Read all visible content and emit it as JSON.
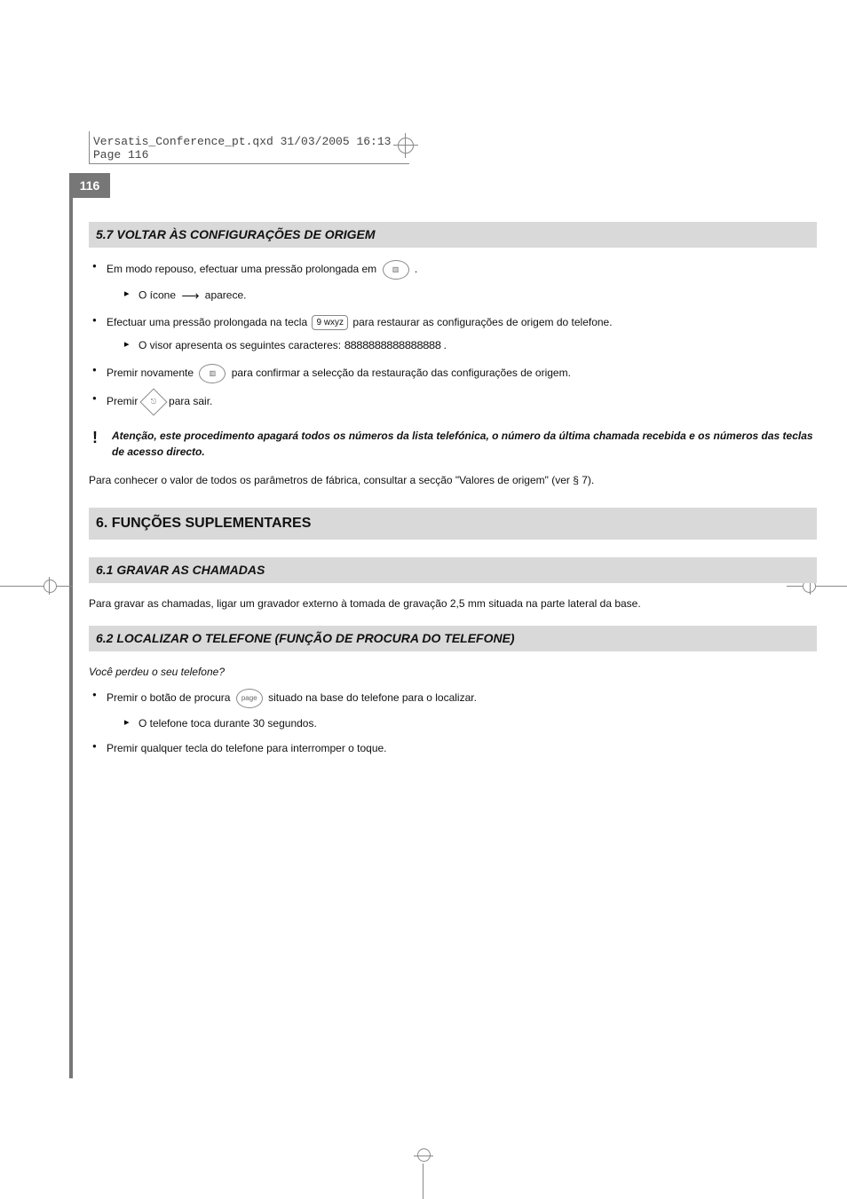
{
  "header": "Versatis_Conference_pt.qxd  31/03/2005  16:13  Page 116",
  "pageNumber": "116",
  "s57": {
    "title": "5.7    VOLTAR ÀS CONFIGURAÇÕES DE ORIGEM",
    "b1": "Em modo repouso, efectuar uma pressão prolongada em ",
    "b1_end": ".",
    "b1_sub_pre": "O ícone ",
    "b1_sub_post": " aparece.",
    "b2_pre": "Efectuar uma pressão prolongada na tecla ",
    "b2_key": "9 wxyz",
    "b2_post": " para restaurar as configurações de origem do telefone.",
    "b2_sub_pre": "O visor apresenta os seguintes caracteres: ",
    "b2_sub_seg": "8888888888888888",
    "b2_sub_post": ".",
    "b3_pre": "Premir novamente ",
    "b3_post": " para confirmar a selecção da restauração das configurações de origem.",
    "b4_pre": "Premir ",
    "b4_post": " para sair.",
    "warn": "Atenção, este procedimento apagará todos os números da lista telefónica, o número da última chamada recebida e os números das teclas de acesso directo.",
    "para": "Para conhecer o valor de todos os parâmetros de fábrica, consultar a secção \"Valores de origem\" (ver § 7)."
  },
  "chap6": "6.   FUNÇÕES SUPLEMENTARES",
  "s61": {
    "title": "6.1    GRAVAR AS CHAMADAS",
    "para": "Para gravar as chamadas, ligar um gravador externo à tomada de gravação 2,5 mm situada na parte lateral da base."
  },
  "s62": {
    "title": "6.2    LOCALIZAR O TELEFONE (FUNÇÃO DE PROCURA DO TELEFONE)",
    "q": "Você perdeu o seu telefone?",
    "b1_pre": "Premir o botão de procura ",
    "b1_label": "page",
    "b1_post": " situado na base do telefone para o localizar.",
    "b1_sub": "O telefone toca durante 30 segundos.",
    "b2": "Premir qualquer tecla do telefone para interromper o toque."
  }
}
